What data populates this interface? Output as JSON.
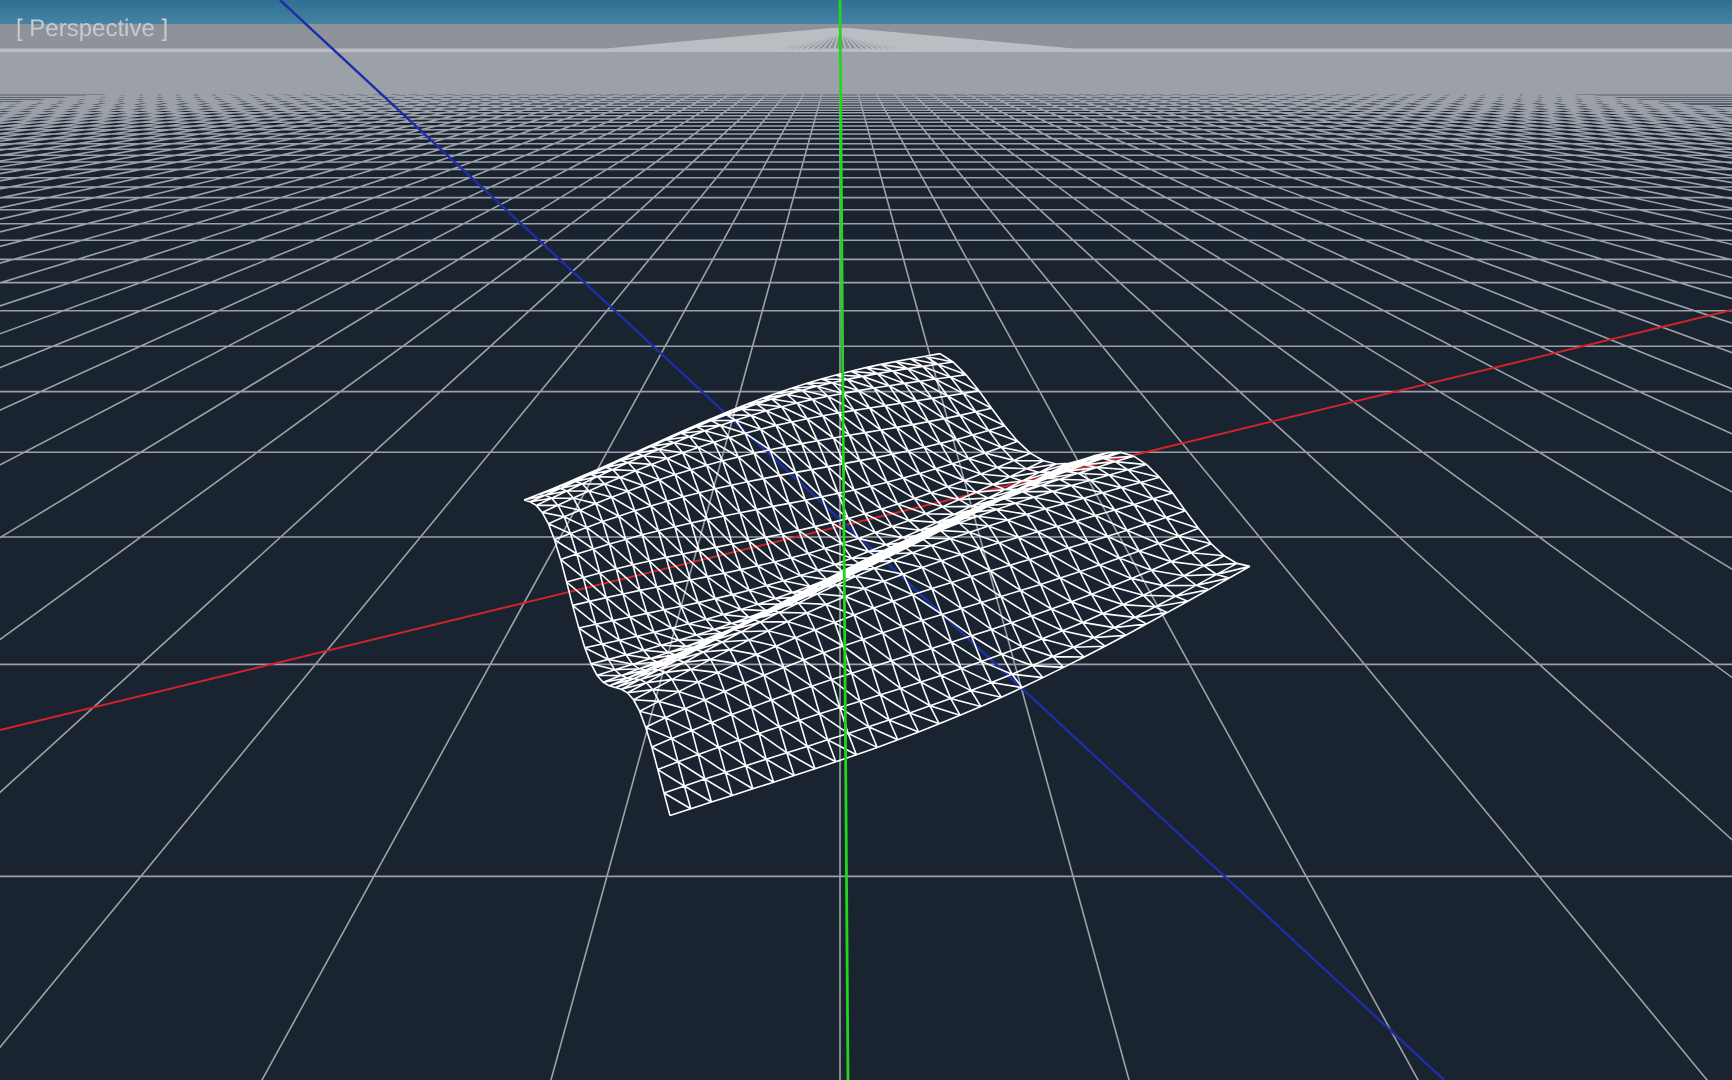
{
  "viewport": {
    "label": "[ Perspective ]"
  }
}
